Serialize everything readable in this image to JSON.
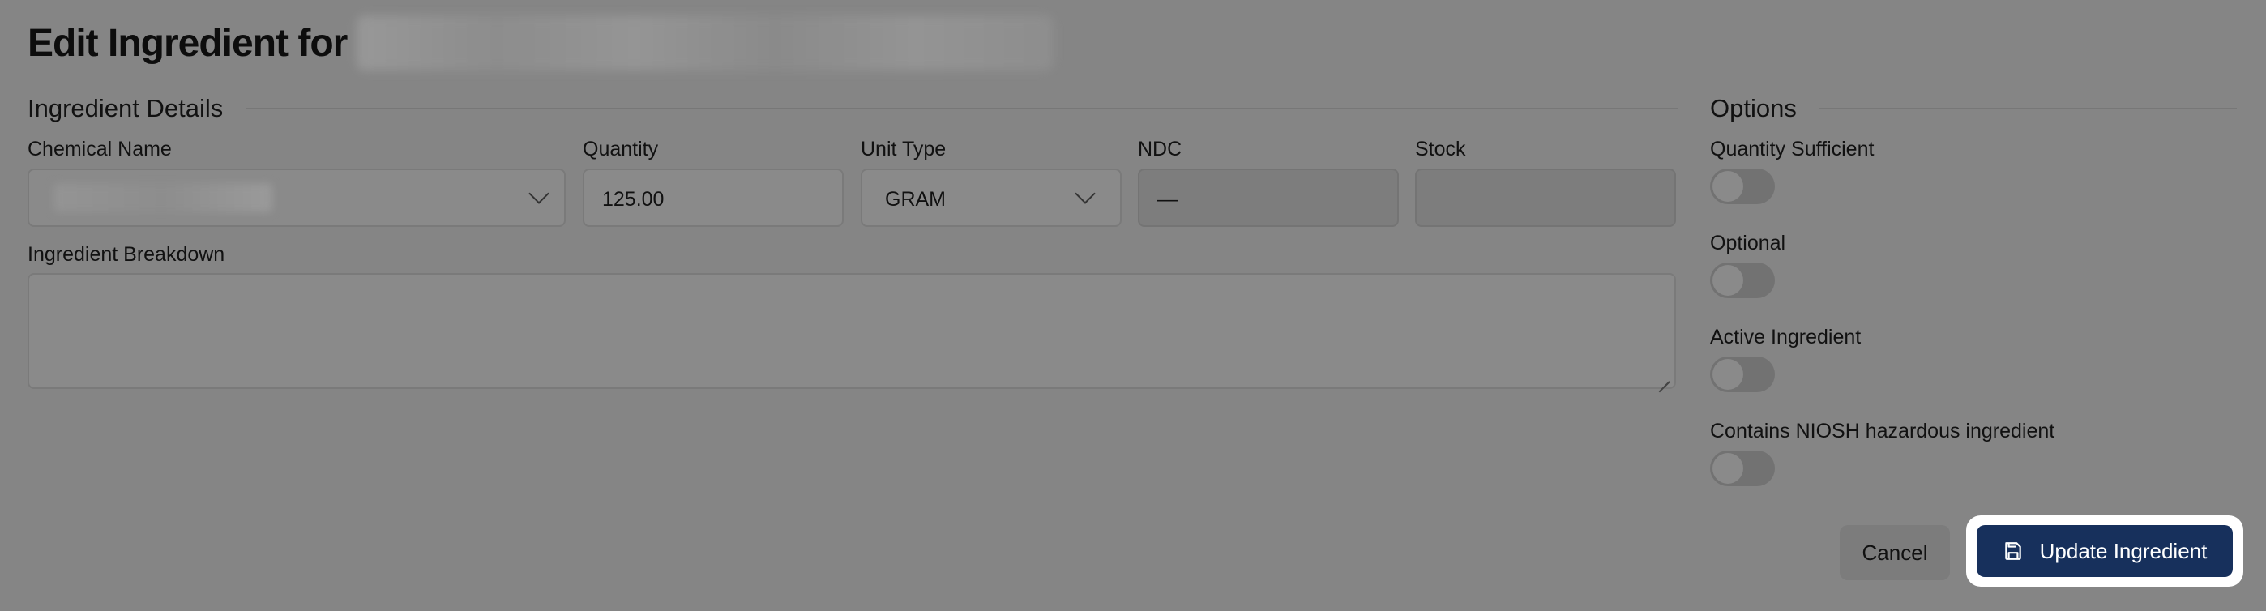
{
  "page": {
    "title": "Edit Ingredient for"
  },
  "details": {
    "heading": "Ingredient Details",
    "chemical_name": {
      "label": "Chemical Name",
      "value": ""
    },
    "quantity": {
      "label": "Quantity",
      "value": "125.00"
    },
    "unit_type": {
      "label": "Unit Type",
      "value": "GRAM"
    },
    "ndc": {
      "label": "NDC",
      "value": "—"
    },
    "stock": {
      "label": "Stock",
      "value": ""
    },
    "breakdown": {
      "label": "Ingredient Breakdown",
      "value": ""
    }
  },
  "options": {
    "heading": "Options",
    "items": [
      {
        "label": "Quantity Sufficient",
        "checked": false
      },
      {
        "label": "Optional",
        "checked": false
      },
      {
        "label": "Active Ingredient",
        "checked": false
      },
      {
        "label": "Contains NIOSH hazardous ingredient",
        "checked": false
      }
    ]
  },
  "actions": {
    "cancel_label": "Cancel",
    "update_label": "Update Ingredient"
  },
  "icons": {
    "select_chevron": "chevron-down-icon",
    "update": "save-icon"
  }
}
